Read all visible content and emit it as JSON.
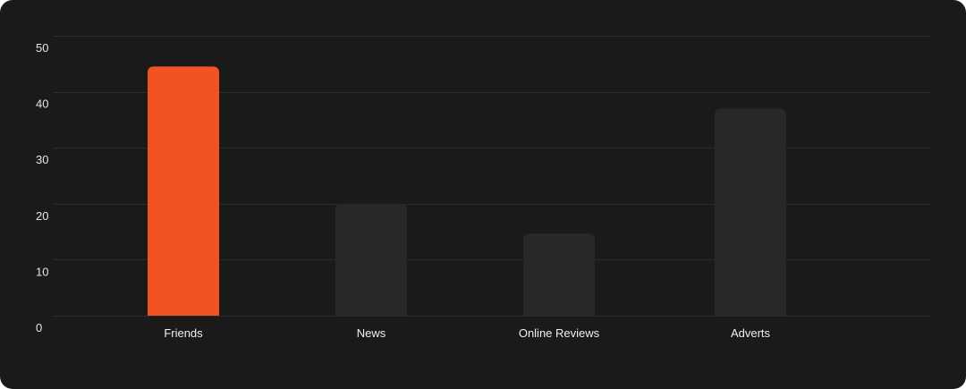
{
  "chart_data": {
    "type": "bar",
    "categories": [
      "Friends",
      "News",
      "Online Reviews",
      "Adverts"
    ],
    "values": [
      44.5,
      20,
      14.7,
      37
    ],
    "ylim": [
      0,
      50
    ],
    "yticks": [
      0,
      10,
      20,
      30,
      40,
      50
    ],
    "grid": true,
    "title": "",
    "xlabel": "",
    "ylabel": ""
  },
  "colors": {
    "background": "#1a1a1a",
    "highlight_bar": "#f25322",
    "default_bar": "#282828",
    "grid": "#2c2c2c",
    "text": "#e6e6e6"
  }
}
